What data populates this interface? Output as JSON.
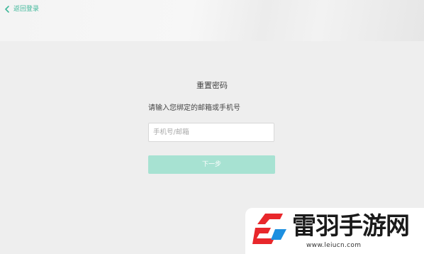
{
  "header": {
    "back_label": "返回登录",
    "back_icon": "chevron-left-icon",
    "accent_color": "#3fb89a"
  },
  "form": {
    "title": "重置密码",
    "prompt": "请输入您绑定的邮箱或手机号",
    "account_input": {
      "value": "",
      "placeholder": "手机号/邮箱"
    },
    "next_button_label": "下一步",
    "next_button_color": "#a7e2d2"
  },
  "watermark": {
    "site_name": "雷羽手游网",
    "url": "www.leiucn.com",
    "logo_icon": "brand-logo-icon",
    "logo_color": "#e8272b"
  }
}
